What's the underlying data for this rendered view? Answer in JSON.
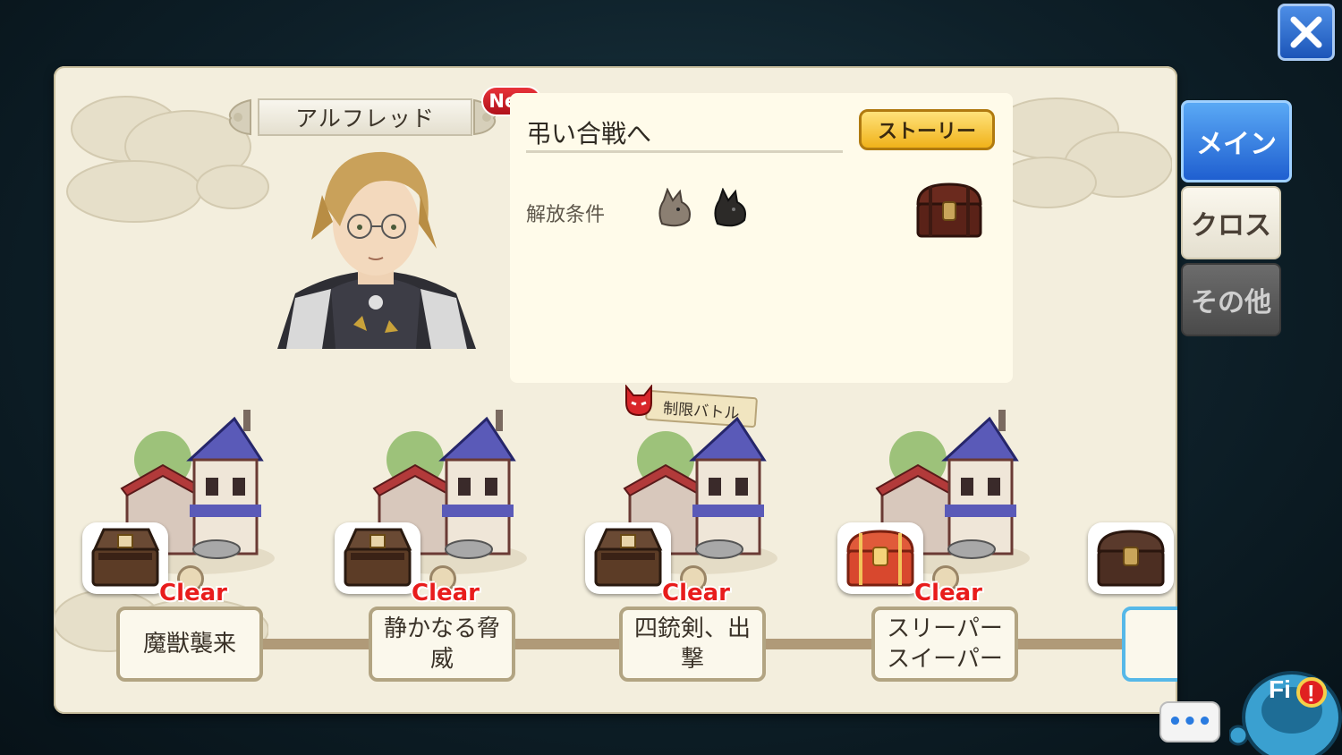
{
  "close": {
    "icon": "close-icon"
  },
  "character": {
    "name": "アルフレッド",
    "new_badge": "New"
  },
  "stage_info": {
    "title": "弔い合戦へ",
    "story_button": "ストーリー",
    "release_label": "解放条件"
  },
  "tabs": [
    {
      "label": "メイン",
      "active": true
    },
    {
      "label": "クロス",
      "active": false
    },
    {
      "label": "その他",
      "active": false
    }
  ],
  "limited_battle": "制限バトル",
  "stages": [
    {
      "label": "魔獣襲来",
      "status": "Clear"
    },
    {
      "label": "静かなる脅威",
      "status": "Clear"
    },
    {
      "label": "四銃剣、出撃",
      "status": "Clear"
    },
    {
      "label": "スリーパースイーパー",
      "status": "Clear"
    }
  ],
  "chat": {
    "label": "•••"
  },
  "mascot": {
    "label": "Fi",
    "alert": "!"
  },
  "colors": {
    "accent_blue": "#1f5fd0",
    "clear_red": "#e81c1c",
    "panel_bg": "#f3eedd"
  }
}
